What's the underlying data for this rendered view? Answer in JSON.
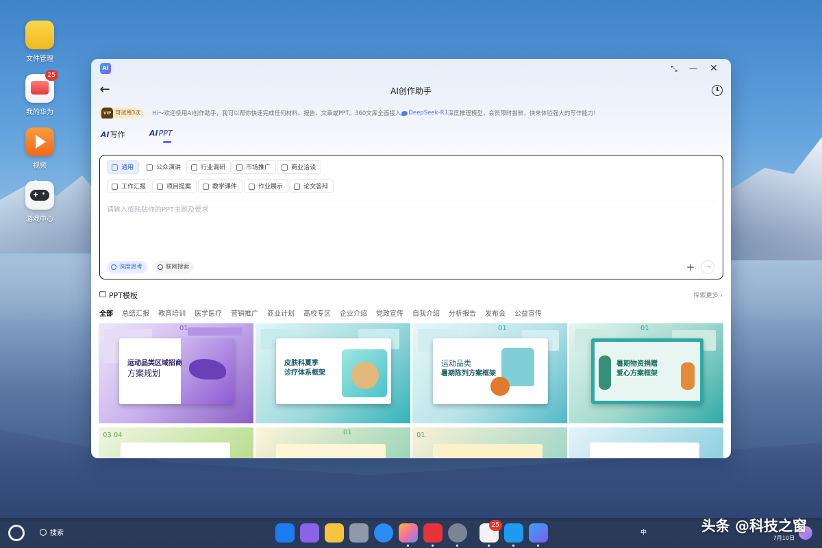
{
  "desktop": {
    "icons": [
      {
        "label": "文件管理",
        "color": "#f7c935"
      },
      {
        "label": "我的华为",
        "color": "#f25b5b",
        "badge": "25"
      },
      {
        "label": "视频",
        "color": "#f5802a"
      },
      {
        "label": "游戏中心",
        "color": "#2c2e36"
      }
    ]
  },
  "window": {
    "app_icon": "AI",
    "title": "AI创作助手",
    "vip": {
      "tag": "VIP",
      "text": "可试用3次"
    },
    "notice": "Hi～欢迎使用AI创作助手，我可以帮你快速完成任何材料、报告、文章或PPT。360文库全面接入",
    "notice_brand": "DeepSeek-R1",
    "notice_tail": "深度推理模型，会员限时尝鲜，快来体验强大的写作能力!",
    "mode_tabs": [
      {
        "prefix": "AI",
        "label": "写作"
      },
      {
        "prefix": "AI",
        "label": "PPT"
      }
    ],
    "scenario_row1": [
      "通用",
      "公众演讲",
      "行业调研",
      "市场推广",
      "商业洽谈"
    ],
    "scenario_row2": [
      "工作汇报",
      "项目提案",
      "教学课件",
      "作业展示",
      "论文答辩"
    ],
    "prompt_value": "",
    "prompt_placeholder": "请输入或粘贴你的PPT主题及要求",
    "deep_think": "深度思考",
    "web_search": "联网搜索",
    "plus": "+",
    "send": "→",
    "templates_title": "PPT模板",
    "explore_more": "探索更多 ›",
    "categories": [
      "全部",
      "总结汇报",
      "教育培训",
      "医学医疗",
      "营销推广",
      "商业计划",
      "高校专区",
      "企业介绍",
      "党政宣传",
      "自我介绍",
      "分析报告",
      "发布会",
      "公益宣传"
    ],
    "templates": [
      {
        "number": "01",
        "title_line1": "运动品类区域招商",
        "title_line2": "方案规划",
        "bg": "#8b5cc7",
        "title_color": "#2d2060"
      },
      {
        "number": "",
        "title_line1": "皮肤科夏季",
        "title_line2": "诊疗体系框架",
        "bg": "#33b3b8",
        "title_color": "#165a6c"
      },
      {
        "number": "01",
        "title_line1": "运动品类",
        "title_line2": "暑期陈列方案框架",
        "bg": "#52b8c7",
        "title_color": "#1e5a66"
      },
      {
        "number": "01",
        "title_line1": "暑期物资捐赠",
        "title_line2": "爱心方案框架",
        "bg": "#2fa9a6",
        "title_color": "#1d6d5f"
      }
    ],
    "template_row2_numbers": [
      "03 04",
      "01",
      "01",
      ""
    ]
  },
  "taskbar": {
    "search": "搜索",
    "dock_badge": "25",
    "tray_ime": "中",
    "date": "7月10日",
    "dock_colors": [
      "#1e7cf2",
      "#8a63e8",
      "#f5c542",
      "#8e9aab",
      "#2a8cf5",
      "#f56fa0",
      "#e8333a",
      "#7b8494",
      "#ef5a5a",
      "#1c9bf0",
      "#3a66f5"
    ]
  },
  "watermark": "头条 @科技之窗"
}
